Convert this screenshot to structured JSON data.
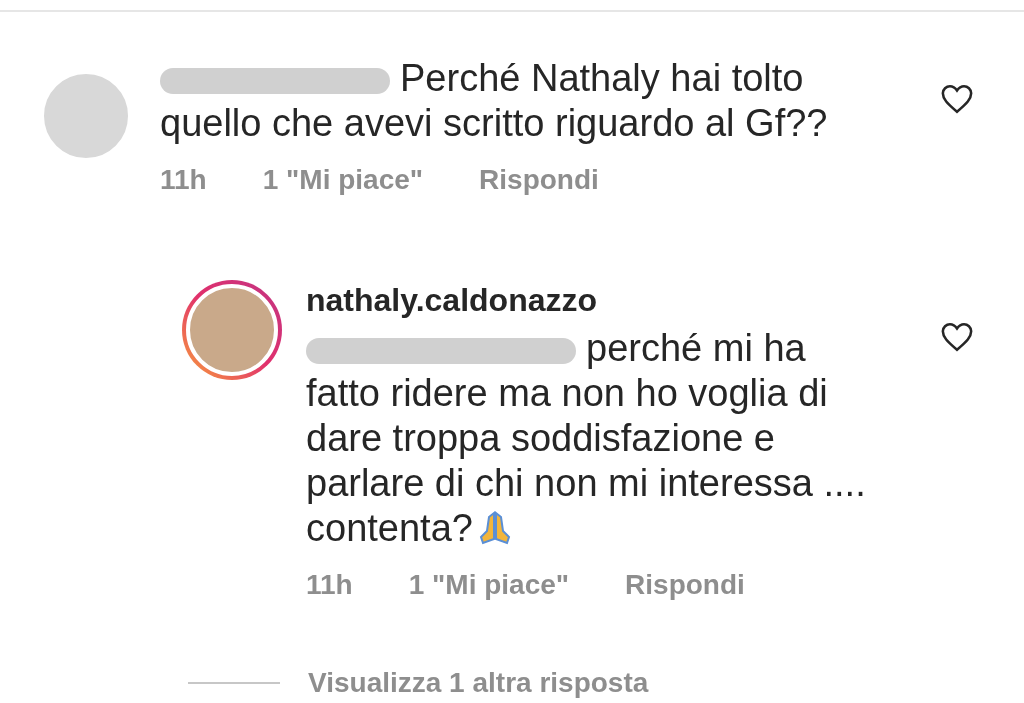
{
  "comments": [
    {
      "kind": "comment",
      "text": "Perché Nathaly hai tolto quello che avevi scritto riguardo al Gf??",
      "time": "11h",
      "likes": "1 \"Mi piace\"",
      "reply": "Rispondi",
      "liked": false
    },
    {
      "kind": "reply",
      "username": "nathaly.caldonazzo",
      "text": "perché mi ha fatto ridere ma non ho voglia di dare troppa soddisfazione e parlare di chi non mi interessa .... contenta?",
      "emoji": true,
      "time": "11h",
      "likes": "1 \"Mi piace\"",
      "reply": "Rispondi",
      "liked": false
    }
  ],
  "view_replies": "Visualizza 1 altra risposta"
}
